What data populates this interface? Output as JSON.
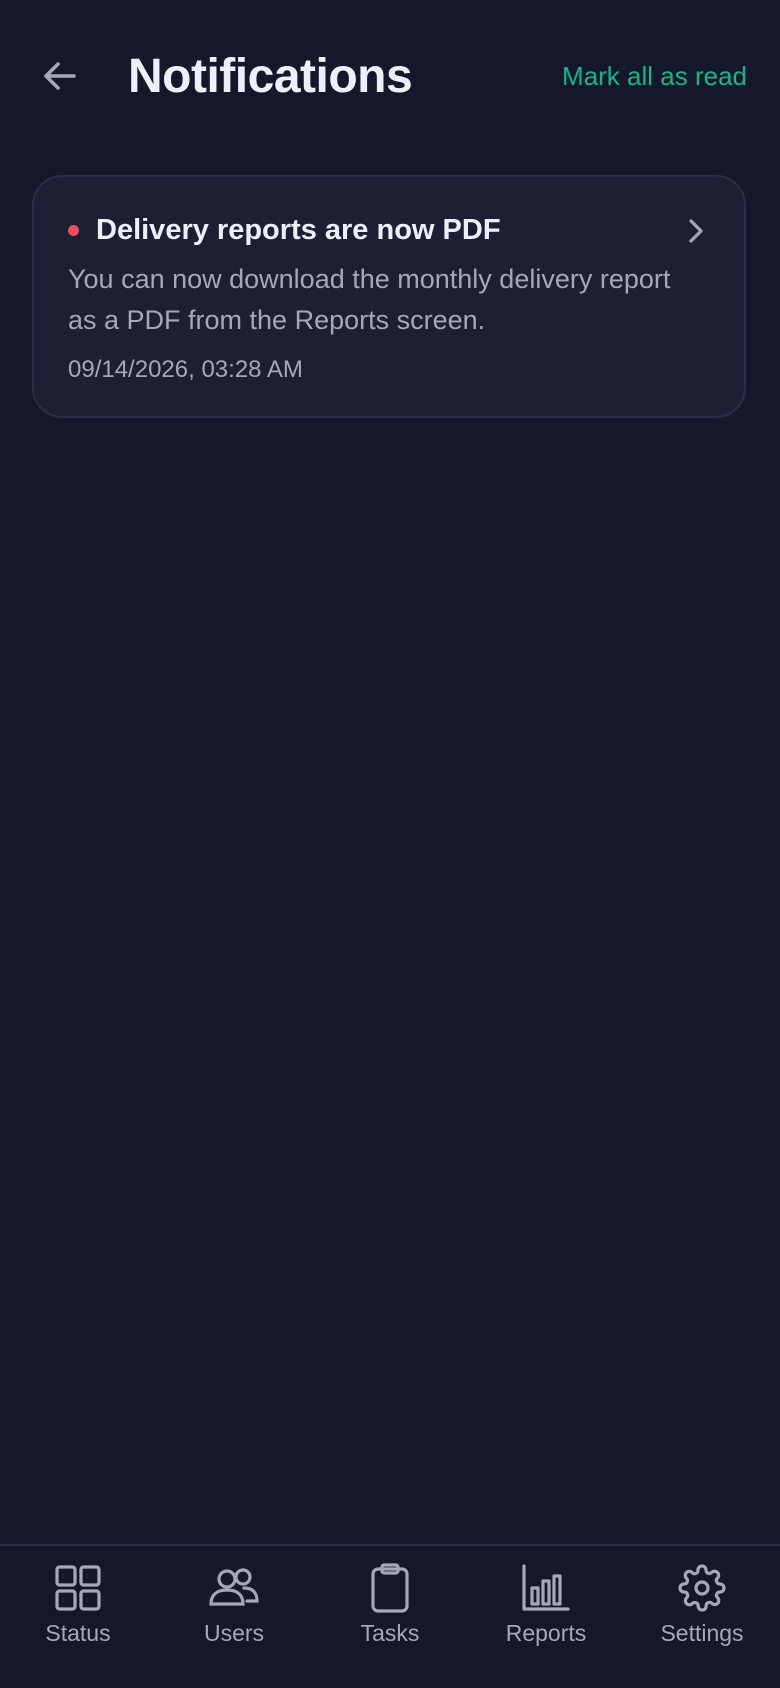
{
  "header": {
    "title": "Notifications",
    "mark_all_label": "Mark all as read",
    "back_icon": "arrow-left-icon"
  },
  "notifications": [
    {
      "title": "Delivery reports are now PDF",
      "body": "You can now download the monthly delivery report as a PDF from the Reports screen.",
      "timestamp": "09/14/2026, 03:28 AM",
      "unread": true
    }
  ],
  "bottom_nav": {
    "items": [
      {
        "label": "Status",
        "icon": "grid-icon"
      },
      {
        "label": "Users",
        "icon": "users-icon"
      },
      {
        "label": "Tasks",
        "icon": "clipboard-icon"
      },
      {
        "label": "Reports",
        "icon": "bar-chart-icon"
      },
      {
        "label": "Settings",
        "icon": "gear-icon"
      }
    ]
  },
  "colors": {
    "background": "#15172a",
    "card": "#1d1f35",
    "accent": "#13b888",
    "unread_dot": "#f24b5e",
    "muted_text": "#a5a8bd"
  }
}
